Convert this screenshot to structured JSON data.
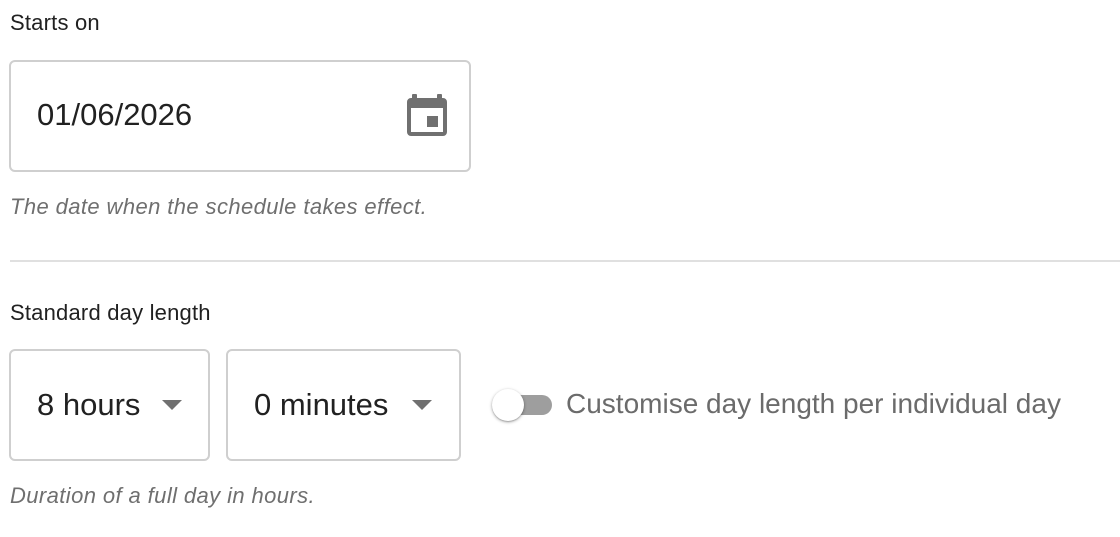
{
  "start": {
    "label": "Starts on",
    "date_value": "01/06/2026",
    "helper": "The date when the schedule takes effect.",
    "icon": "calendar-icon"
  },
  "day_length": {
    "label": "Standard day length",
    "hours_selected": "8 hours",
    "minutes_selected": "0 minutes",
    "toggle_label": "Customise day length per individual day",
    "toggle_on": false,
    "helper": "Duration of a full day in hours."
  },
  "colors": {
    "border": "#cfcfcf",
    "helper_text": "#6f6f6f",
    "toggle_off_track": "#9e9e9e",
    "icon": "#707070"
  }
}
